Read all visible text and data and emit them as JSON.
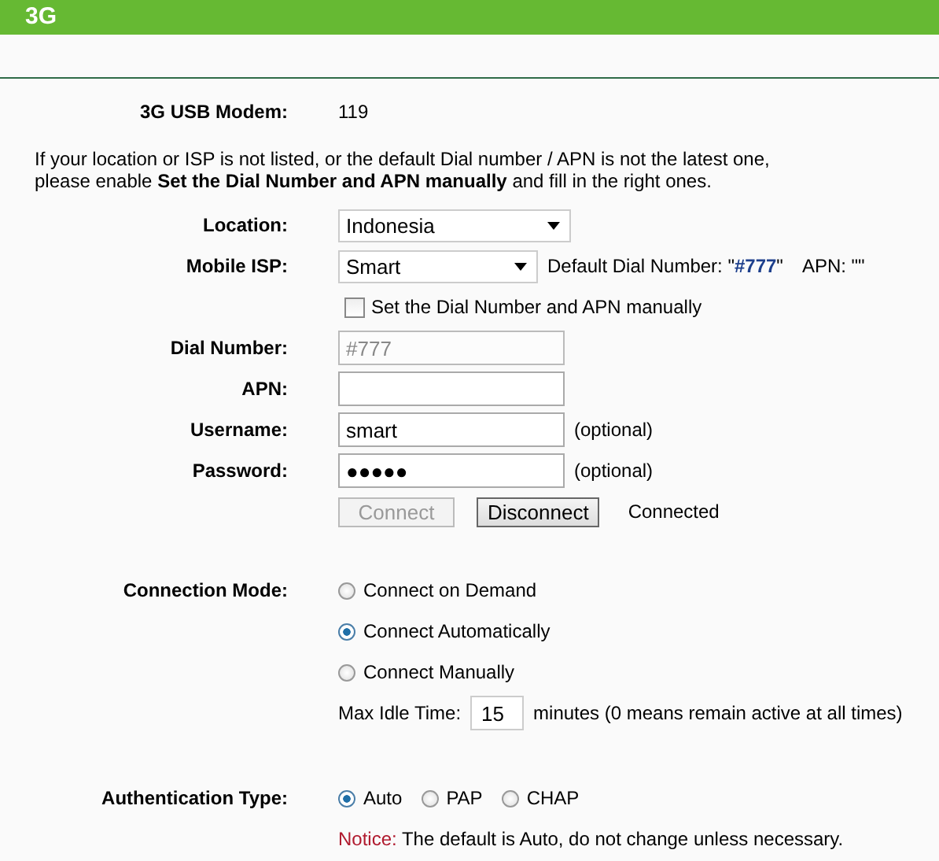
{
  "header": {
    "title": "3G"
  },
  "modem": {
    "label": "3G USB Modem:",
    "value": "119"
  },
  "intro": "If your location or ISP is not listed, or the default Dial number / APN is not the latest one,\nplease enable **Set the Dial Number and APN manually** and fill in the right ones.",
  "location": {
    "label": "Location:",
    "value": "Indonesia"
  },
  "isp": {
    "label": "Mobile ISP:",
    "value": "Smart",
    "default_dial": "Default Dial Number: \"**#777**\"",
    "default_apn": "APN: \"\""
  },
  "manual": {
    "label": "Set the Dial Number and APN manually",
    "checked": false
  },
  "fields": [
    {
      "label": "Dial Number:",
      "value": "#777",
      "disabled": true
    },
    {
      "label": "APN:",
      "disabled": false
    },
    {
      "label": "Username:",
      "value": "smart",
      "disabled": false,
      "note": "(optional)"
    },
    {
      "label": "Password:",
      "value": "●●●●●",
      "disabled": false,
      "note": "(optional)"
    }
  ],
  "buttons": [
    {
      "label": "Connect",
      "disabled": true
    },
    {
      "label": "Disconnect",
      "disabled": false
    }
  ],
  "status": "Connected",
  "connection_mode": {
    "label": "Connection Mode:",
    "options": [
      {
        "label": "Connect on Demand",
        "selected": false
      },
      {
        "label": "Connect Automatically",
        "selected": true
      },
      {
        "label": "Connect Manually",
        "selected": false
      }
    ]
  },
  "idle": {
    "label": "Max Idle Time:",
    "value": "15",
    "note": "minutes (0 means remain active at all times)"
  },
  "auth": {
    "label": "Authentication Type:",
    "options": [
      {
        "label": "Auto",
        "selected": true
      },
      {
        "label": "PAP",
        "selected": false
      },
      {
        "label": "CHAP",
        "selected": false
      }
    ]
  },
  "notice": {
    "prefix": "Notice:",
    "text": " The default is Auto, do not change unless necessary."
  }
}
